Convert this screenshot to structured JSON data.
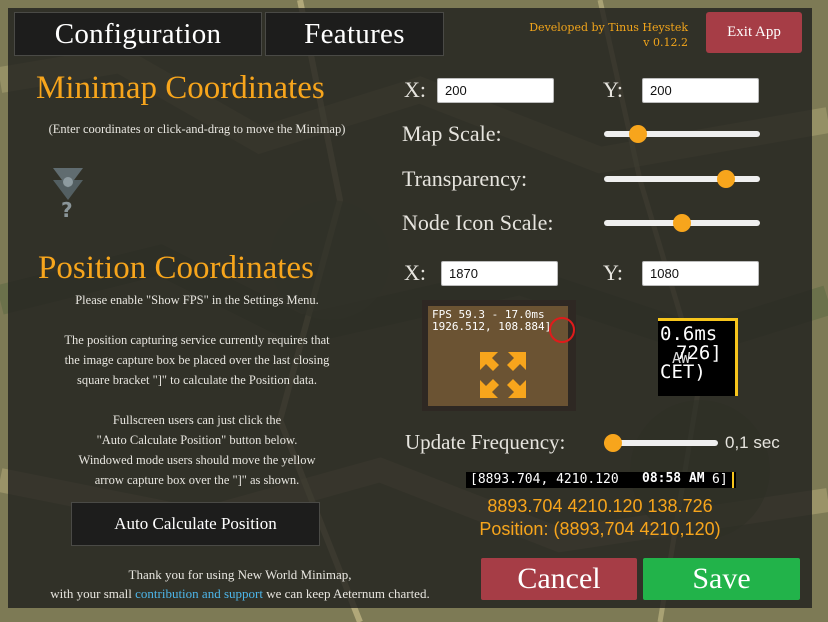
{
  "tabs": [
    {
      "label": "Configuration"
    },
    {
      "label": "Features"
    }
  ],
  "developer": {
    "credit": "Developed by Tinus Heystek",
    "version": "v 0.12.2"
  },
  "exit_label": "Exit App",
  "minimap": {
    "title": "Minimap Coordinates",
    "hint": "(Enter coordinates or click-and-drag to move the Minimap)",
    "x_label": "X:",
    "x_value": "200",
    "y_label": "Y:",
    "y_value": "200",
    "preview_icon": "minimap-marker-icon",
    "preview_glyph": "?"
  },
  "settings": {
    "map_scale_label": "Map Scale:",
    "map_scale_level": 0.18,
    "transparency_label": "Transparency:",
    "transparency_level": 0.82,
    "node_icon_scale_label": "Node Icon Scale:",
    "node_icon_scale_level": 0.5
  },
  "position": {
    "title": "Position Coordinates",
    "notes": [
      "Please enable \"Show FPS\" in the Settings Menu.",
      "",
      "The position capturing service currently requires that",
      "the image capture box be placed over the last closing",
      "square bracket \"]\" to calculate the Position data.",
      "",
      "Fullscreen users can just click the",
      "\"Auto Calculate Position\" button below.",
      "Windowed mode users should move the yellow",
      "arrow capture box over the \"]\" as shown."
    ],
    "x_label": "X:",
    "x_value": "1870",
    "y_label": "Y:",
    "y_value": "1080",
    "auto_calc_label": "Auto Calculate Position"
  },
  "example_capture": {
    "fps_line": "FPS 59.3 - 17.0ms",
    "coords_line": "1926.512, 108.884]",
    "move_icon": "move-arrows-icon",
    "circle_icon": "red-circle-icon"
  },
  "live_capture": {
    "line1": "0.6ms",
    "line2": "726]",
    "line3": "AW",
    "line4": "CET)"
  },
  "update_frequency": {
    "label": "Update Frequency:",
    "level": 0.0,
    "value": "0,1 sec"
  },
  "readout": {
    "ocr_line": "[8893.704, 4210.120",
    "ocr_overlay": "08:58 AM",
    "ocr_tail": "6]",
    "parsed": "8893.704 4210.120 138.726",
    "position": "Position: (8893,704  4210,120)"
  },
  "buttons": {
    "cancel": "Cancel",
    "save": "Save"
  },
  "thanks": {
    "line1": "Thank you for using New World Minimap,",
    "line2_pre": "with your small ",
    "line2_link": "contribution and support",
    "line2_post": " we can keep Aeternum charted."
  },
  "colors": {
    "accent": "#f7a51c",
    "exit": "#a63d46",
    "cancel": "#a63d46",
    "save": "#22b34a",
    "link": "#4db6ea"
  }
}
